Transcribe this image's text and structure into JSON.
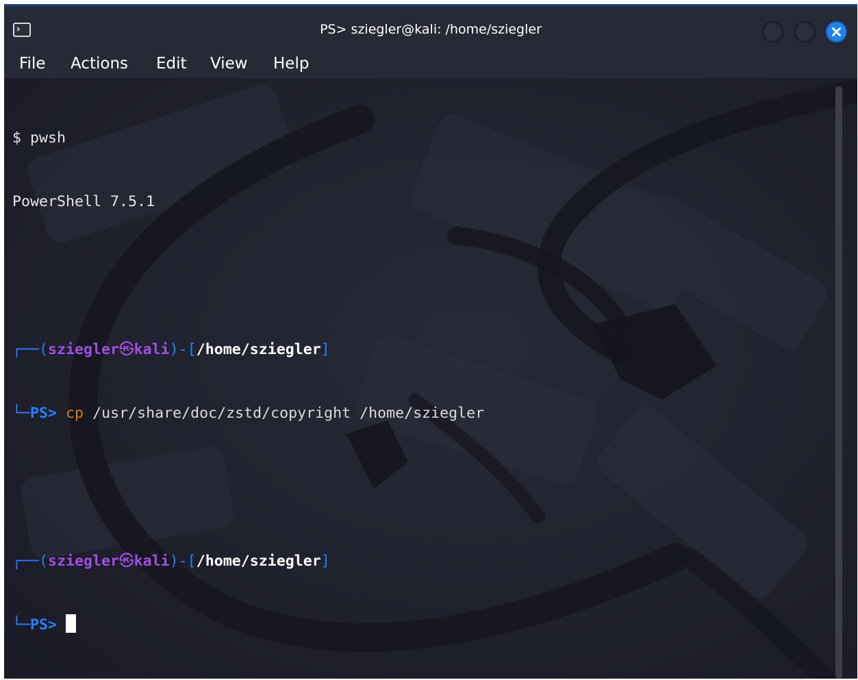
{
  "window": {
    "title": "PS> sziegler@kali: /home/sziegler",
    "icon": "terminal-icon",
    "close_icon": "close-icon",
    "accent": "#1f83f0"
  },
  "menu": {
    "items": [
      "File",
      "Actions",
      "Edit",
      "View",
      "Help"
    ]
  },
  "terminal": {
    "line1_prompt": "$ ",
    "line1_cmd": "pwsh",
    "line2": "PowerShell 7.5.1",
    "prompt_open": "(",
    "user": "sziegler",
    "at_symbol": "㉿",
    "host": "kali",
    "prompt_mid": ")-[",
    "path": "/home/sziegler",
    "prompt_close": "]",
    "ps_label": "PS>",
    "cmd_name": "cp",
    "cmd_args": "/usr/share/doc/zstd/copyright /home/sziegler",
    "colors": {
      "user": "#a04fe3",
      "bracket": "#2a7fff",
      "command": "#d67b27"
    }
  }
}
